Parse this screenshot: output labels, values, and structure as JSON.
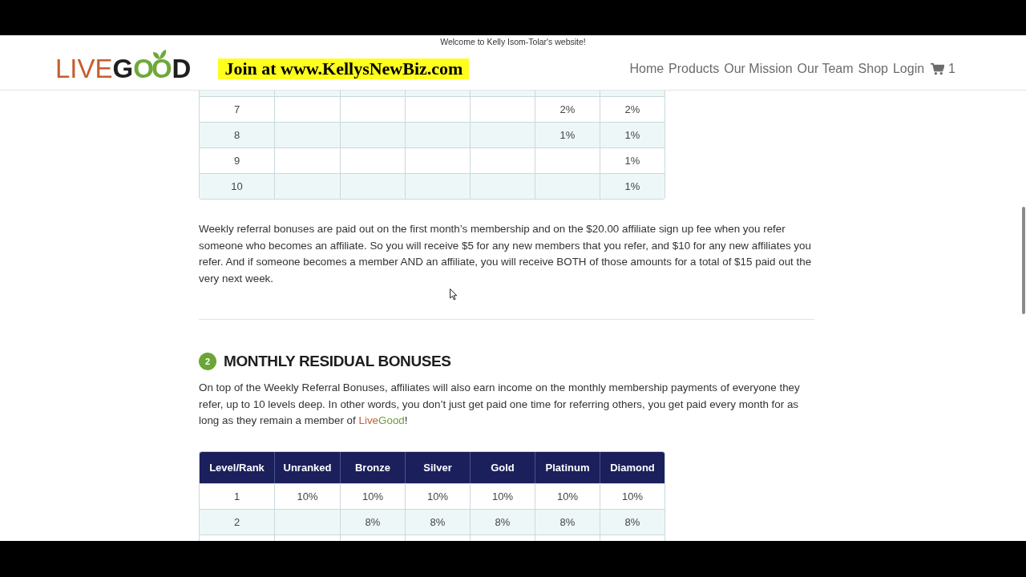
{
  "header": {
    "welcome": "Welcome to Kelly Isom-Tolar's website!",
    "logo": [
      {
        "text": "LIVE",
        "kind": "light"
      },
      {
        "text": "G",
        "kind": "dark"
      },
      {
        "text": "OO",
        "kind": "accent"
      },
      {
        "text": "D",
        "kind": "dark"
      }
    ],
    "banner": "Join at www.KellysNewBiz.com",
    "nav": [
      "Home",
      "Products",
      "Our Mission",
      "Our Team",
      "Shop",
      "Login"
    ],
    "cart_count": "1"
  },
  "referral_table": {
    "rows": [
      [
        "7",
        null,
        null,
        null,
        null,
        "2%",
        "2%"
      ],
      [
        "8",
        null,
        null,
        null,
        null,
        "1%",
        "1%"
      ],
      [
        "9",
        null,
        null,
        null,
        null,
        null,
        "1%"
      ],
      [
        "10",
        null,
        null,
        null,
        null,
        null,
        "1%"
      ]
    ]
  },
  "referral_paragraph": "Weekly referral bonuses are paid out on the first month’s membership and on the $20.00 affiliate sign up fee when you refer someone who becomes an affiliate. So you will receive $5 for any new members that you refer, and $10 for any new affiliates you refer. And if someone becomes a member AND an affiliate, you will receive BOTH of those amounts for a total of $15 paid out the very next week.",
  "section": {
    "number": "2",
    "title": "MONTHLY RESIDUAL BONUSES",
    "paragraph": [
      {
        "kind": "text",
        "text": "On top of the Weekly Referral Bonuses, affiliates will also earn income on the monthly membership payments of everyone they refer, up to 10 levels deep. In other words, you don’t just get paid one time for referring others, you get paid every month for as long as they remain a member of "
      },
      {
        "kind": "brand_first",
        "text": "Live"
      },
      {
        "kind": "brand_second",
        "text": "Good"
      },
      {
        "kind": "text",
        "text": "!"
      }
    ]
  },
  "residual_table": {
    "columns": [
      "Level/Rank",
      "Unranked",
      "Bronze",
      "Silver",
      "Gold",
      "Platinum",
      "Diamond"
    ],
    "rows": [
      [
        "1",
        "10%",
        "10%",
        "10%",
        "10%",
        "10%",
        "10%"
      ],
      [
        "2",
        null,
        "8%",
        "8%",
        "8%",
        "8%",
        "8%"
      ]
    ]
  }
}
